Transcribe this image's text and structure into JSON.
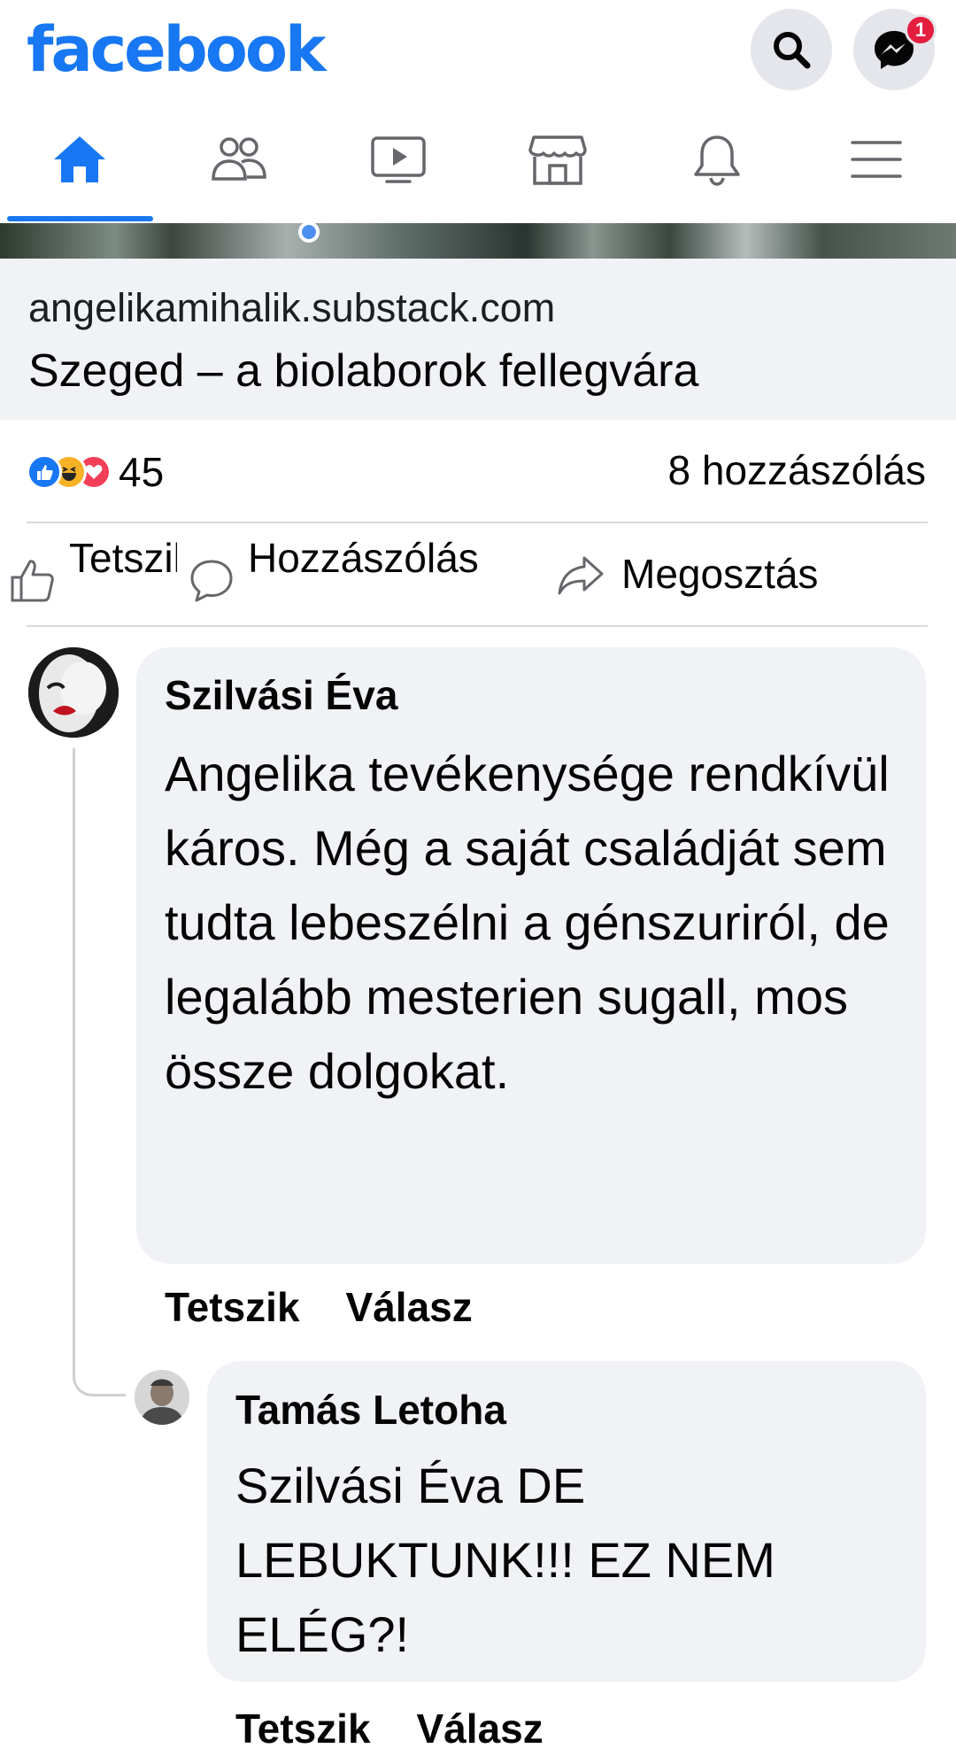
{
  "header": {
    "logo": "facebook",
    "notification_badge": "1",
    "brand_color": "#1877f2"
  },
  "nav": {
    "tabs": [
      {
        "icon": "home-icon",
        "active": true
      },
      {
        "icon": "friends-icon",
        "active": false
      },
      {
        "icon": "watch-icon",
        "active": false
      },
      {
        "icon": "marketplace-icon",
        "active": false
      },
      {
        "icon": "bell-icon",
        "active": false
      },
      {
        "icon": "menu-icon",
        "active": false
      }
    ]
  },
  "link_preview": {
    "domain": "angelikamihalik.substack.com",
    "title": "Szeged – a biolaborok fellegvára"
  },
  "stats": {
    "reaction_icons": [
      "like-reaction-icon",
      "haha-reaction-icon",
      "love-reaction-icon"
    ],
    "reaction_count": "45",
    "comment_count": "8 hozzászólás"
  },
  "actions": {
    "like": "Tetszik",
    "comment": "Hozzászólás",
    "share": "Megosztás"
  },
  "comments": [
    {
      "author": "Szilvási Éva",
      "text": "Angelika tevékenysége rendkívül káros. Még a saját családját sem tudta lebeszélni a génszuriról, de legalább mesterien sugall, mos össze dolgokat.",
      "like_label": "Tetszik",
      "reply_label": "Válasz"
    },
    {
      "author": "Tamás Letoha",
      "text": "Szilvási Éva DE LEBUKTUNK!!! EZ NEM ELÉG?!",
      "like_label": "Tetszik",
      "reply_label": "Válasz"
    }
  ]
}
